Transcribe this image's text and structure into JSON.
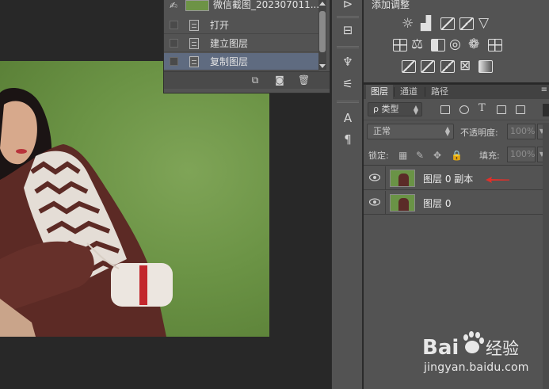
{
  "history": {
    "snapshot_name": "微信截图_202307011...",
    "items": [
      {
        "label": "打开",
        "selected": false
      },
      {
        "label": "建立图层",
        "selected": false
      },
      {
        "label": "复制图层",
        "selected": true
      }
    ]
  },
  "adjustments": {
    "title": "添加调整",
    "icons": [
      "brightness-contrast-icon",
      "levels-icon",
      "curves-icon",
      "exposure-icon",
      "vibrance-icon",
      "hue-saturation-icon",
      "color-balance-icon",
      "black-white-icon",
      "photo-filter-icon",
      "channel-mixer-icon",
      "color-lookup-icon",
      "invert-icon",
      "posterize-icon",
      "threshold-icon",
      "selective-color-icon",
      "gradient-map-icon"
    ]
  },
  "layers": {
    "tabs": [
      {
        "label": "图层",
        "active": true
      },
      {
        "label": "通道",
        "active": false
      },
      {
        "label": "路径",
        "active": false
      }
    ],
    "filter_label": "ρ 类型",
    "blend_mode": "正常",
    "opacity_label": "不透明度:",
    "opacity_value": "100%",
    "lock_label": "锁定:",
    "fill_label": "填充:",
    "fill_value": "100%",
    "rows": [
      {
        "name": "图层 0 副本",
        "visible": true
      },
      {
        "name": "图层 0",
        "visible": true
      }
    ]
  },
  "annotation": {
    "arrow_color": "#e0302a"
  },
  "watermark": {
    "logo_text": "Bai经验",
    "url": "jingyan.baidu.com"
  },
  "colors": {
    "selection": "#5f6b80",
    "panel": "#535353",
    "background": "#282828"
  }
}
